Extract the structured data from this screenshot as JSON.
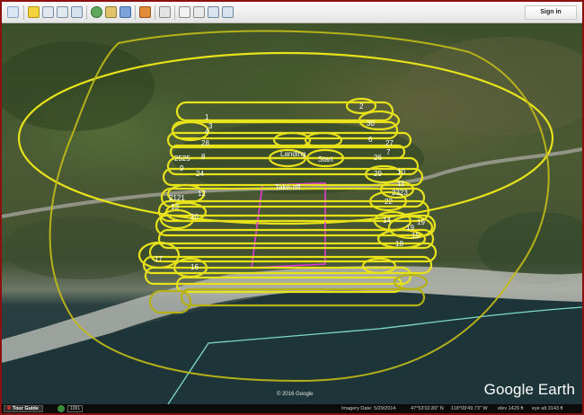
{
  "toolbar": {
    "signin_label": "Sign in",
    "buttons": [
      "hide-sidebar-icon",
      "placemark-icon",
      "polygon-icon",
      "path-icon",
      "image-overlay-icon",
      "record-tour-icon",
      "historical-imagery-icon",
      "sun-icon",
      "planets-icon",
      "ruler-icon",
      "email-icon",
      "print-icon",
      "save-image-icon",
      "view-in-maps-icon"
    ]
  },
  "map": {
    "copyright": "© 2016 Google",
    "logo": "Google Earth",
    "path_labels": [
      {
        "id": "2",
        "text": "2"
      },
      {
        "id": "1",
        "text": "1"
      },
      {
        "id": "30",
        "text": "30"
      },
      {
        "id": "3",
        "text": "3"
      },
      {
        "id": "4",
        "text": "4"
      },
      {
        "id": "28",
        "text": "28"
      },
      {
        "id": "6",
        "text": "6"
      },
      {
        "id": "27",
        "text": "27"
      },
      {
        "id": "26",
        "text": "26"
      },
      {
        "id": "7",
        "text": "7"
      },
      {
        "id": "2525",
        "text": "2525"
      },
      {
        "id": "8",
        "text": "8"
      },
      {
        "id": "landing",
        "text": "Landing"
      },
      {
        "id": "start",
        "text": "Start"
      },
      {
        "id": "9",
        "text": "9"
      },
      {
        "id": "29",
        "text": "29"
      },
      {
        "id": "10",
        "text": "10"
      },
      {
        "id": "11",
        "text": "11"
      },
      {
        "id": "24",
        "text": "24"
      },
      {
        "id": "takeoff",
        "text": "Take-off"
      },
      {
        "id": "12",
        "text": "12"
      },
      {
        "id": "2121",
        "text": "2121"
      },
      {
        "id": "2323",
        "text": "2323"
      },
      {
        "id": "13",
        "text": "13"
      },
      {
        "id": "22",
        "text": "22"
      },
      {
        "id": "20",
        "text": "20"
      },
      {
        "id": "14",
        "text": "14"
      },
      {
        "id": "19",
        "text": "19"
      },
      {
        "id": "19b",
        "text": "19"
      },
      {
        "id": "15",
        "text": "15"
      },
      {
        "id": "18",
        "text": "18"
      },
      {
        "id": "17",
        "text": "17"
      },
      {
        "id": "16",
        "text": "16"
      }
    ]
  },
  "statusbar": {
    "tour_label": "Tour Guide",
    "count": "1991",
    "imagery_date": "Imagery Date: 5/29/2014",
    "lat": "47°53'02.80\" N",
    "lon": "118°09'49.73\" W",
    "elev": "elev  1429 ft",
    "eye_alt": "eye alt  3143 ft"
  },
  "colors": {
    "path": "#e8e21a",
    "takeoff_area": "#e33ad8",
    "boundary": "#7fd9c8"
  }
}
